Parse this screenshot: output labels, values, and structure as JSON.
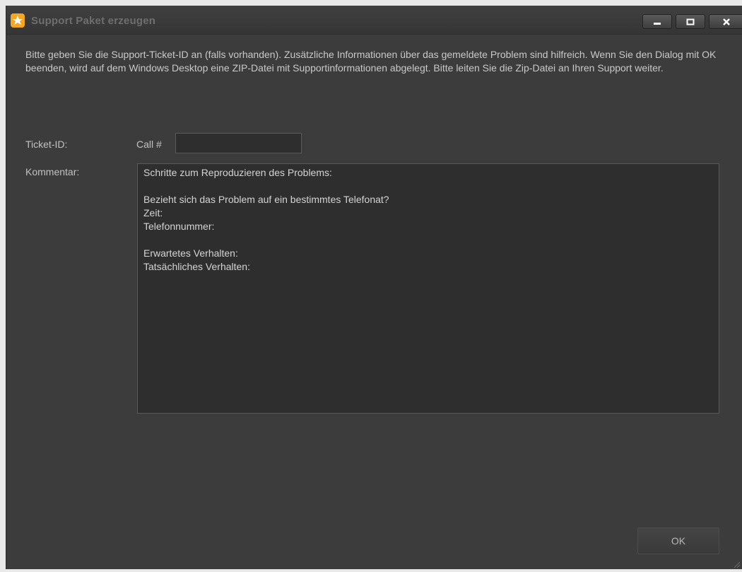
{
  "window": {
    "title": "Support Paket erzeugen",
    "icon": "orange-star-app-icon",
    "controls": [
      "minimize-icon",
      "maximize-icon",
      "close-icon"
    ]
  },
  "info_text": "Bitte geben Sie die Support-Ticket-ID an (falls vorhanden). Zusätzliche Informationen über das gemeldete Problem sind hilfreich. Wenn Sie den Dialog mit OK beenden, wird auf dem Windows Desktop eine ZIP-Datei mit Supportinformationen abgelegt. Bitte leiten Sie die Zip-Datei an Ihren Support weiter.",
  "form": {
    "ticket_label": "Ticket-ID:",
    "call_prefix": "Call #",
    "ticket_value": "",
    "comment_label": "Kommentar:",
    "comment_value": "Schritte zum Reproduzieren des Problems:\n\nBezieht sich das Problem auf ein bestimmtes Telefonat?\nZeit:\nTelefonnummer:\n\nErwartetes Verhalten:\nTatsächliches Verhalten:"
  },
  "buttons": {
    "ok_label": "OK"
  },
  "colors": {
    "background": "#3c3c3c",
    "field": "#2e2e2e",
    "icon_accent": "#f5a623"
  }
}
